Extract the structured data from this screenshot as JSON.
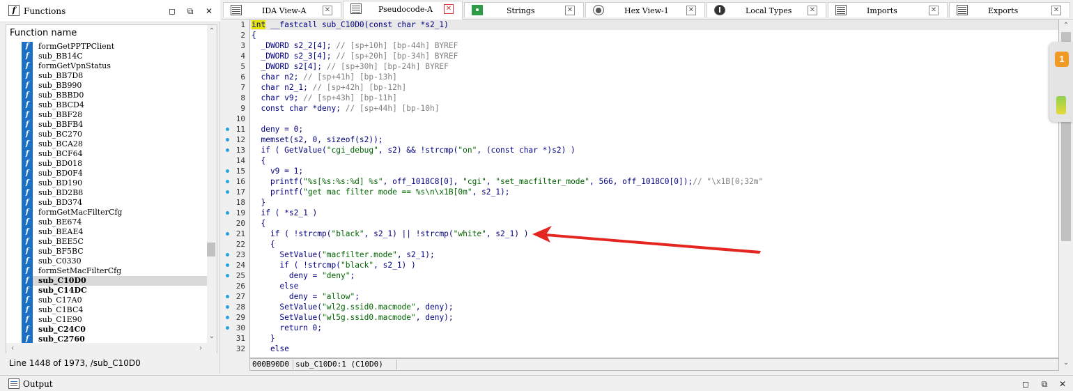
{
  "functions_panel": {
    "title": "Functions",
    "column_header": "Function name",
    "items": [
      {
        "name": "formGetPPTPClient",
        "bold": false
      },
      {
        "name": "sub_BB14C",
        "bold": false
      },
      {
        "name": "formGetVpnStatus",
        "bold": false
      },
      {
        "name": "sub_BB7D8",
        "bold": false
      },
      {
        "name": "sub_BB990",
        "bold": false
      },
      {
        "name": "sub_BBBD0",
        "bold": false
      },
      {
        "name": "sub_BBCD4",
        "bold": false
      },
      {
        "name": "sub_BBF28",
        "bold": false
      },
      {
        "name": "sub_BBFB4",
        "bold": false
      },
      {
        "name": "sub_BC270",
        "bold": false
      },
      {
        "name": "sub_BCA28",
        "bold": false
      },
      {
        "name": "sub_BCF64",
        "bold": false
      },
      {
        "name": "sub_BD018",
        "bold": false
      },
      {
        "name": "sub_BD0F4",
        "bold": false
      },
      {
        "name": "sub_BD190",
        "bold": false
      },
      {
        "name": "sub_BD2B8",
        "bold": false
      },
      {
        "name": "sub_BD374",
        "bold": false
      },
      {
        "name": "formGetMacFilterCfg",
        "bold": false
      },
      {
        "name": "sub_BE674",
        "bold": false
      },
      {
        "name": "sub_BEAE4",
        "bold": false
      },
      {
        "name": "sub_BEE5C",
        "bold": false
      },
      {
        "name": "sub_BF5BC",
        "bold": false
      },
      {
        "name": "sub_C0330",
        "bold": false
      },
      {
        "name": "formSetMacFilterCfg",
        "bold": false
      },
      {
        "name": "sub_C10D0",
        "bold": true,
        "selected": true
      },
      {
        "name": "sub_C14DC",
        "bold": true
      },
      {
        "name": "sub_C17A0",
        "bold": false
      },
      {
        "name": "sub_C1BC4",
        "bold": false
      },
      {
        "name": "sub_C1E90",
        "bold": false
      },
      {
        "name": "sub_C24C0",
        "bold": true
      },
      {
        "name": "sub_C2760",
        "bold": true
      }
    ],
    "status": "Line 1448 of 1973, /sub_C10D0"
  },
  "tabs": [
    {
      "label": "IDA View-A",
      "icon": "ida-view-icon",
      "active": false
    },
    {
      "label": "Pseudocode-A",
      "icon": "pseudocode-icon",
      "active": true
    },
    {
      "label": "Strings",
      "icon": "strings-icon",
      "active": false
    },
    {
      "label": "Hex View-1",
      "icon": "hex-view-icon",
      "active": false
    },
    {
      "label": "Local Types",
      "icon": "local-types-icon",
      "active": false
    },
    {
      "label": "Imports",
      "icon": "imports-icon",
      "active": false
    },
    {
      "label": "Exports",
      "icon": "exports-icon",
      "active": false
    }
  ],
  "code": {
    "line_numbers": [
      "1",
      "2",
      "3",
      "4",
      "5",
      "6",
      "7",
      "8",
      "9",
      "10",
      "11",
      "12",
      "13",
      "14",
      "15",
      "16",
      "17",
      "18",
      "19",
      "20",
      "21",
      "22",
      "23",
      "24",
      "25",
      "26",
      "27",
      "28",
      "29",
      "30",
      "31",
      "32"
    ],
    "dots": [
      false,
      false,
      false,
      false,
      false,
      false,
      false,
      false,
      false,
      false,
      true,
      true,
      true,
      false,
      true,
      true,
      true,
      false,
      true,
      false,
      true,
      false,
      true,
      true,
      true,
      false,
      true,
      true,
      true,
      true,
      false,
      false
    ],
    "lines": [
      [
        {
          "t": "int",
          "c": "hl"
        },
        {
          "t": " __fastcall sub_C10D0(const char *s2_1)",
          "c": "kw"
        }
      ],
      [
        {
          "t": "{",
          "c": "kw"
        }
      ],
      [
        {
          "t": "  _DWORD s2_2[4]; ",
          "c": "kw"
        },
        {
          "t": "// [sp+10h] [bp-44h] BYREF",
          "c": "cmt"
        }
      ],
      [
        {
          "t": "  _DWORD s2_3[4]; ",
          "c": "kw"
        },
        {
          "t": "// [sp+20h] [bp-34h] BYREF",
          "c": "cmt"
        }
      ],
      [
        {
          "t": "  _DWORD s2[4]; ",
          "c": "kw"
        },
        {
          "t": "// [sp+30h] [bp-24h] BYREF",
          "c": "cmt"
        }
      ],
      [
        {
          "t": "  char n2; ",
          "c": "kw"
        },
        {
          "t": "// [sp+41h] [bp-13h]",
          "c": "cmt"
        }
      ],
      [
        {
          "t": "  char n2_1; ",
          "c": "kw"
        },
        {
          "t": "// [sp+42h] [bp-12h]",
          "c": "cmt"
        }
      ],
      [
        {
          "t": "  char v9; ",
          "c": "kw"
        },
        {
          "t": "// [sp+43h] [bp-11h]",
          "c": "cmt"
        }
      ],
      [
        {
          "t": "  const char *deny; ",
          "c": "kw"
        },
        {
          "t": "// [sp+44h] [bp-10h]",
          "c": "cmt"
        }
      ],
      [
        {
          "t": "",
          "c": "kw"
        }
      ],
      [
        {
          "t": "  deny = 0;",
          "c": "kw"
        }
      ],
      [
        {
          "t": "  memset(s2, 0, sizeof(s2));",
          "c": "kw"
        }
      ],
      [
        {
          "t": "  if ( GetValue(",
          "c": "kw"
        },
        {
          "t": "\"cgi_debug\"",
          "c": "str"
        },
        {
          "t": ", s2) && !strcmp(",
          "c": "kw"
        },
        {
          "t": "\"on\"",
          "c": "str"
        },
        {
          "t": ", (const char *)s2) )",
          "c": "kw"
        }
      ],
      [
        {
          "t": "  {",
          "c": "kw"
        }
      ],
      [
        {
          "t": "    v9 = 1;",
          "c": "kw"
        }
      ],
      [
        {
          "t": "    printf(",
          "c": "kw"
        },
        {
          "t": "\"%s[%s:%s:%d] %s\"",
          "c": "str"
        },
        {
          "t": ", off_1018C8[0], ",
          "c": "kw"
        },
        {
          "t": "\"cgi\"",
          "c": "str"
        },
        {
          "t": ", ",
          "c": "kw"
        },
        {
          "t": "\"set_macfilter_mode\"",
          "c": "str"
        },
        {
          "t": ", 566, off_1018C0[0]);",
          "c": "kw"
        },
        {
          "t": "// \"\\x1B[0;32m\"",
          "c": "cmt"
        }
      ],
      [
        {
          "t": "    printf(",
          "c": "kw"
        },
        {
          "t": "\"get mac filter mode == %s\\n\\x1B[0m\"",
          "c": "str"
        },
        {
          "t": ", s2_1);",
          "c": "kw"
        }
      ],
      [
        {
          "t": "  }",
          "c": "kw"
        }
      ],
      [
        {
          "t": "  if ( *s2_1 )",
          "c": "kw"
        }
      ],
      [
        {
          "t": "  {",
          "c": "kw"
        }
      ],
      [
        {
          "t": "    if ( !strcmp(",
          "c": "kw"
        },
        {
          "t": "\"black\"",
          "c": "str"
        },
        {
          "t": ", s2_1) || !strcmp(",
          "c": "kw"
        },
        {
          "t": "\"white\"",
          "c": "str"
        },
        {
          "t": ", s2_1) )",
          "c": "kw"
        }
      ],
      [
        {
          "t": "    {",
          "c": "kw"
        }
      ],
      [
        {
          "t": "      SetValue(",
          "c": "kw"
        },
        {
          "t": "\"macfilter.mode\"",
          "c": "str"
        },
        {
          "t": ", s2_1);",
          "c": "kw"
        }
      ],
      [
        {
          "t": "      if ( !strcmp(",
          "c": "kw"
        },
        {
          "t": "\"black\"",
          "c": "str"
        },
        {
          "t": ", s2_1) )",
          "c": "kw"
        }
      ],
      [
        {
          "t": "        deny = ",
          "c": "kw"
        },
        {
          "t": "\"deny\"",
          "c": "str"
        },
        {
          "t": ";",
          "c": "kw"
        }
      ],
      [
        {
          "t": "      else",
          "c": "kw"
        }
      ],
      [
        {
          "t": "        deny = ",
          "c": "kw"
        },
        {
          "t": "\"allow\"",
          "c": "str"
        },
        {
          "t": ";",
          "c": "kw"
        }
      ],
      [
        {
          "t": "      SetValue(",
          "c": "kw"
        },
        {
          "t": "\"wl2g.ssid0.macmode\"",
          "c": "str"
        },
        {
          "t": ", deny);",
          "c": "kw"
        }
      ],
      [
        {
          "t": "      SetValue(",
          "c": "kw"
        },
        {
          "t": "\"wl5g.ssid0.macmode\"",
          "c": "str"
        },
        {
          "t": ", deny);",
          "c": "kw"
        }
      ],
      [
        {
          "t": "      return 0;",
          "c": "kw"
        }
      ],
      [
        {
          "t": "    }",
          "c": "kw"
        }
      ],
      [
        {
          "t": "    else",
          "c": "kw"
        }
      ]
    ],
    "status_address": "000B90D0",
    "status_location": "sub_C10D0:1 (C10D0)"
  },
  "side_widget": {
    "badge": "1"
  },
  "output_panel": {
    "title": "Output"
  },
  "colors": {
    "accent": "#1b6fc4",
    "highlight": "#e5e500",
    "string": "#006400",
    "comment": "#808080",
    "code": "#000080",
    "arrow": "#e52620"
  }
}
